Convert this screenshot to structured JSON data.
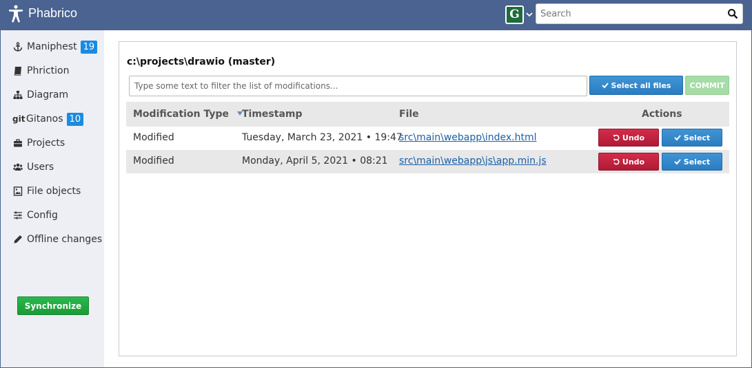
{
  "app": {
    "title": "Phabrico"
  },
  "header": {
    "avatar_letter": "G",
    "search": {
      "placeholder": "Search"
    }
  },
  "sidebar": {
    "items": [
      {
        "label": "Maniphest",
        "icon": "anchor-icon",
        "badge": "19"
      },
      {
        "label": "Phriction",
        "icon": "book-icon"
      },
      {
        "label": "Diagram",
        "icon": "sitemap-icon"
      },
      {
        "label": "Gitanos",
        "icon": "git-icon",
        "icon_text": "git",
        "badge": "10"
      },
      {
        "label": "Projects",
        "icon": "briefcase-icon"
      },
      {
        "label": "Users",
        "icon": "users-icon"
      },
      {
        "label": "File objects",
        "icon": "image-file-icon"
      },
      {
        "label": "Config",
        "icon": "sliders-icon"
      },
      {
        "label": "Offline changes",
        "icon": "pencil-icon"
      }
    ],
    "sync_label": "Synchronize"
  },
  "main": {
    "repo_title": "c:\\projects\\drawio (master)",
    "filter": {
      "placeholder": "Type some text to filter the list of modifications..."
    },
    "select_all_label": "Select all files",
    "commit_label": "COMMIT",
    "table": {
      "headers": {
        "type": "Modification Type",
        "timestamp": "Timestamp",
        "file": "File",
        "actions": "Actions"
      },
      "rows": [
        {
          "type": "Modified",
          "timestamp": "Tuesday, March 23, 2021 • 19:47",
          "file": "src\\main\\webapp\\index.html",
          "undo": "Undo",
          "select": "Select"
        },
        {
          "type": "Modified",
          "timestamp": "Monday, April 5, 2021 • 08:21",
          "file": "src\\main\\webapp\\js\\app.min.js",
          "undo": "Undo",
          "select": "Select"
        }
      ]
    }
  },
  "colors": {
    "topbar": "#4a6390",
    "sidebar": "#edeff4",
    "badge": "#1a8be0",
    "primary": "#2b7cc0",
    "danger": "#b01a35",
    "success": "#1a9a35"
  }
}
